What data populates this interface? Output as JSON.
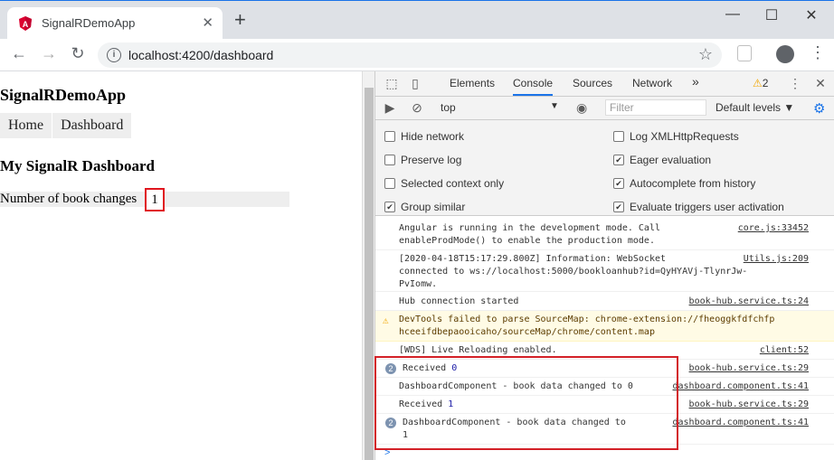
{
  "browser": {
    "tab_title": "SignalRDemoApp",
    "new_tab": "+",
    "url": "localhost:4200/dashboard"
  },
  "app": {
    "title": "SignalRDemoApp",
    "nav": [
      "Home",
      "Dashboard"
    ],
    "heading": "My SignalR Dashboard",
    "count_label": "Number of book changes",
    "count_value": "1"
  },
  "devtools": {
    "tabs": [
      "Elements",
      "Console",
      "Sources",
      "Network"
    ],
    "active_tab": "Console",
    "more": "»",
    "warnings": "2",
    "context": "top",
    "filter_placeholder": "Filter",
    "levels": "Default levels",
    "options_left": [
      {
        "label": "Hide network",
        "checked": false
      },
      {
        "label": "Preserve log",
        "checked": false
      },
      {
        "label": "Selected context only",
        "checked": false
      },
      {
        "label": "Group similar",
        "checked": true
      }
    ],
    "options_right": [
      {
        "label": "Log XMLHttpRequests",
        "checked": false
      },
      {
        "label": "Eager evaluation",
        "checked": true
      },
      {
        "label": "Autocomplete from history",
        "checked": true
      },
      {
        "label": "Evaluate triggers user activation",
        "checked": true
      }
    ],
    "logs": [
      {
        "msg": "Angular is running in the development mode. Call\nenableProdMode() to enable the production mode.",
        "src": "core.js:33452"
      },
      {
        "msg": "[2020-04-18T15:17:29.800Z] Information: WebSocket\nconnected to ws://localhost:5000/bookloanhub?id=QyHYAVj-TlynrJw-\nPvIomw.",
        "src": "Utils.js:209"
      },
      {
        "msg": "Hub connection started",
        "src": "book-hub.service.ts:24"
      },
      {
        "msg": "DevTools failed to parse SourceMap: chrome-extension://fheoggkfdfchfp\nhceeifdbepaooicaho/sourceMap/chrome/content.map",
        "src": ""
      },
      {
        "msg": "[WDS] Live Reloading enabled.",
        "src": "client:52"
      },
      {
        "msg_prefix": "Received ",
        "msg_value": "0",
        "badge": "2",
        "src": "book-hub.service.ts:29"
      },
      {
        "msg": "DashboardComponent - book data changed to 0",
        "src": "dashboard.component.ts:41"
      },
      {
        "msg_prefix": "Received ",
        "msg_value": "1",
        "src": "book-hub.service.ts:29"
      },
      {
        "msg": "DashboardComponent - book data changed to\n1",
        "badge": "2",
        "src": "dashboard.component.ts:41"
      }
    ],
    "prompt": ">"
  }
}
